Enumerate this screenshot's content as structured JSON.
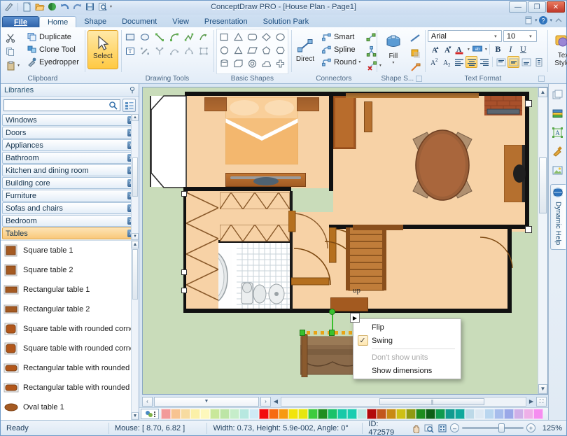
{
  "window": {
    "title": "ConceptDraw PRO - [House Plan - Page1]",
    "minimize": "—",
    "maximize": "❐",
    "close": "✕"
  },
  "quick_access": [
    {
      "name": "pen-icon",
      "glyph": "✒"
    },
    {
      "name": "new-document-icon",
      "glyph": "📄"
    },
    {
      "name": "open-folder-icon",
      "glyph": "📁"
    },
    {
      "name": "save-icon",
      "glyph": "💾"
    },
    {
      "name": "undo-icon",
      "glyph": "↶"
    },
    {
      "name": "redo-icon",
      "glyph": "↷"
    },
    {
      "name": "save-as-icon",
      "glyph": "🖫"
    },
    {
      "name": "print-preview-icon",
      "glyph": "🔍"
    }
  ],
  "tabs": [
    {
      "label": "File",
      "active": false,
      "file": true
    },
    {
      "label": "Home",
      "active": true
    },
    {
      "label": "Shape",
      "active": false
    },
    {
      "label": "Document",
      "active": false
    },
    {
      "label": "View",
      "active": false
    },
    {
      "label": "Presentation",
      "active": false
    },
    {
      "label": "Solution Park",
      "active": false
    }
  ],
  "tabbar_right": [
    {
      "name": "new-window-icon",
      "glyph": "❒"
    },
    {
      "name": "help-icon",
      "glyph": "?"
    },
    {
      "name": "collapse-ribbon-icon",
      "glyph": "⌃"
    }
  ],
  "ribbon": {
    "groups": [
      {
        "name": "clipboard",
        "label": "Clipboard",
        "small_left": [
          {
            "label": "",
            "icon": "cut-icon"
          },
          {
            "label": "",
            "icon": "copy-icon"
          },
          {
            "label": "",
            "icon": "paste-icon"
          }
        ],
        "items": [
          {
            "label": "Duplicate",
            "icon": "duplicate-icon"
          },
          {
            "label": "Clone Tool",
            "icon": "clone-tool-icon"
          },
          {
            "label": "Eyedropper",
            "icon": "eyedropper-icon"
          }
        ]
      },
      {
        "name": "select",
        "label": "",
        "button": {
          "label": "Select",
          "icon": "cursor-arrow-icon",
          "selected": true
        }
      },
      {
        "name": "drawing-tools",
        "label": "Drawing Tools",
        "row1": [
          "rectangle-tool-icon",
          "ellipse-tool-icon",
          "line-tool-icon",
          "arc-tool-icon",
          "polyline-tool-icon",
          "freeform-tool-icon"
        ],
        "row2": [
          "text-tool-icon",
          "pencil-tool-icon",
          "connect-points-icon",
          "edit-points-icon",
          "bezier-tool-icon",
          "point-edit-icon"
        ]
      },
      {
        "name": "basic-shapes",
        "label": "Basic Shapes",
        "row1": [
          "square-shape-icon",
          "triangle-shape-icon",
          "rounded-rect-shape-icon",
          "diamond-shape-icon",
          "ellipse-shape-icon"
        ],
        "row2": [
          "circle-shape-icon",
          "triangle2-shape-icon",
          "parallelogram-shape-icon",
          "pentagon-shape-icon",
          "hexagon-shape-icon"
        ],
        "row3": [
          "cylinder-shape-icon",
          "cube-shape-icon",
          "donut-shape-icon",
          "cloud-shape-icon",
          "cross-shape-icon"
        ]
      },
      {
        "name": "connectors",
        "label": "Connectors",
        "big": {
          "label": "Direct",
          "icon": "direct-connector-icon"
        },
        "items": [
          {
            "label": "Smart",
            "icon": "smart-connector-icon"
          },
          {
            "label": "Spline",
            "icon": "spline-connector-icon"
          },
          {
            "label": "Round",
            "icon": "round-connector-icon",
            "dropdown": true
          }
        ],
        "extra": [
          "connector-style-icon",
          "hub-connector-icon",
          "remove-connector-icon"
        ]
      },
      {
        "name": "shape-style",
        "label": "Shape S...",
        "big": {
          "label": "Fill",
          "icon": "fill-bucket-icon",
          "dropdown": true
        },
        "side": [
          "line-style-icon",
          "shadow-style-icon",
          "format-painter-icon"
        ]
      },
      {
        "name": "text-format",
        "label": "Text Format",
        "font_family": "Arial",
        "font_size": "10",
        "row_a": [
          "grow-font-icon",
          "shrink-font-icon",
          "font-color-icon",
          "highlight-color-icon",
          "bold-icon",
          "italic-icon",
          "underline-icon"
        ],
        "row_b": [
          "superscript-icon",
          "subscript-icon",
          "align-left-icon",
          "align-center-icon",
          "align-right-icon",
          "align-top-icon",
          "align-middle-icon",
          "align-bottom-icon",
          "text-block-icon"
        ],
        "bold": "B",
        "italic": "I",
        "underline": "U",
        "grow": "A",
        "shrink": "A",
        "sup": "A",
        "sub": "A"
      },
      {
        "name": "text-style",
        "label": "",
        "button": {
          "label1": "Text",
          "label2": "Style",
          "icon": "text-style-icon",
          "dropdown": true
        }
      }
    ]
  },
  "libraries": {
    "title": "Libraries",
    "pin_icon": "pin-icon",
    "search_value": "",
    "search_placeholder": "",
    "search_icon": "search-icon",
    "tree_toggle_icon": "tree-view-icon",
    "items": [
      {
        "label": "Windows",
        "active": false
      },
      {
        "label": "Doors",
        "active": false
      },
      {
        "label": "Appliances",
        "active": false
      },
      {
        "label": "Bathroom",
        "active": false
      },
      {
        "label": "Kitchen and dining room",
        "active": false
      },
      {
        "label": "Building core",
        "active": false
      },
      {
        "label": "Furniture",
        "active": false
      },
      {
        "label": "Sofas and chairs",
        "active": false
      },
      {
        "label": "Bedroom",
        "active": false
      },
      {
        "label": "Tables",
        "active": true
      }
    ],
    "close_glyph": "✕",
    "shapes": [
      {
        "label": "Square table 1",
        "thumb": "square-table-1-thumb",
        "kind": "square"
      },
      {
        "label": "Square table 2",
        "thumb": "square-table-2-thumb",
        "kind": "square"
      },
      {
        "label": "Rectangular table 1",
        "thumb": "rectangular-table-1-thumb",
        "kind": "rect"
      },
      {
        "label": "Rectangular table 2",
        "thumb": "rectangular-table-2-thumb",
        "kind": "rect"
      },
      {
        "label": "Square table with rounded corners ",
        "thumb": "square-table-rounded-1-thumb",
        "kind": "square-round"
      },
      {
        "label": "Square table with rounded corners ",
        "thumb": "square-table-rounded-2-thumb",
        "kind": "square-round"
      },
      {
        "label": "Rectangular table with rounded cor",
        "thumb": "rect-table-rounded-1-thumb",
        "kind": "rect-round"
      },
      {
        "label": "Rectangular table with rounded cor",
        "thumb": "rect-table-rounded-2-thumb",
        "kind": "rect-round"
      },
      {
        "label": "Oval table 1",
        "thumb": "oval-table-1-thumb",
        "kind": "oval"
      }
    ]
  },
  "canvas": {
    "label_up": "up",
    "page_tab_glyph": "▼",
    "scroll_left_glyph": "‹",
    "scroll_right_glyph": "›"
  },
  "context_menu": {
    "items": [
      {
        "label": "Flip",
        "checked": false,
        "disabled": false
      },
      {
        "label": "Swing",
        "checked": true,
        "disabled": false
      },
      {
        "label": "Don't show units",
        "checked": false,
        "disabled": true
      },
      {
        "label": "Show dimensions",
        "checked": false,
        "disabled": false
      }
    ],
    "check_glyph": "✓",
    "handle_glyph": "▶"
  },
  "palette": {
    "colors": [
      "#f29a9a",
      "#f7c391",
      "#f7dba0",
      "#fbf0a8",
      "#fdf8bc",
      "#c9e89a",
      "#bde5a6",
      "#c6edca",
      "#b7e8e0",
      "#cfeaf5",
      "#f20d0d",
      "#f66a12",
      "#f79a12",
      "#f2e40b",
      "#e6e60f",
      "#3ecb3e",
      "#1f8e1f",
      "#19c269",
      "#17c9a8",
      "#19cdb0",
      "#bfe8e3",
      "#b30b0b",
      "#c2561d",
      "#c88a14",
      "#cec015",
      "#8f9a12",
      "#1e8c1e",
      "#0e5f17",
      "#0f9a4e",
      "#109a8f",
      "#0fa89c",
      "#bcd9e8",
      "#dde9f3",
      "#b9d6ef",
      "#a7bdec",
      "#9aa8e8",
      "#cfb0e8",
      "#eeb0e8",
      "#f58ef0"
    ]
  },
  "statusbar": {
    "ready": "Ready",
    "mouse": "Mouse: [ 8.70, 6.82 ]",
    "dimensions": "Width: 0.73,  Height: 5.9e-002,  Angle: 0°",
    "id": "ID: 472579",
    "zoom": "125%",
    "zoom_out_glyph": "–",
    "zoom_in_glyph": "+",
    "tools": [
      {
        "name": "pan-hand-icon",
        "glyph": "✋"
      },
      {
        "name": "zoom-tool-icon",
        "glyph": "🔍"
      },
      {
        "name": "fit-page-icon",
        "glyph": "⛶"
      }
    ]
  },
  "right_strip": {
    "icons": [
      {
        "name": "layers-icon",
        "glyph": "❐"
      },
      {
        "name": "library-books-icon",
        "glyph": "📚"
      },
      {
        "name": "text-shape-icon",
        "glyph": "A"
      },
      {
        "name": "brush-icon",
        "glyph": "🖌"
      },
      {
        "name": "image-icon",
        "glyph": "🖼"
      }
    ],
    "dynamic_help": {
      "label": "Dynamic Help",
      "icon": "help-globe-icon"
    }
  }
}
